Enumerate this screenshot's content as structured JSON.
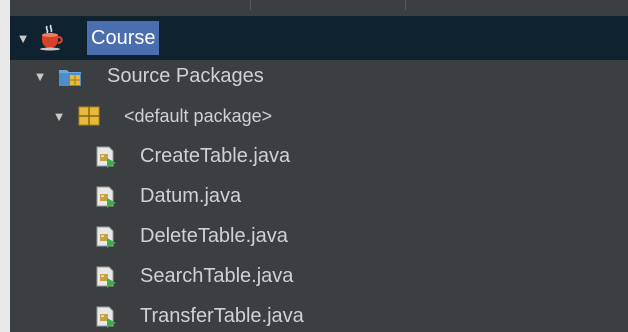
{
  "project_tree": {
    "root": {
      "label": "Course",
      "expanded": true,
      "selected": true,
      "icon": "java-project-cup-icon"
    },
    "source_packages": {
      "label": "Source Packages",
      "expanded": true,
      "icon": "source-packages-folder-icon"
    },
    "default_package": {
      "label": "<default package>",
      "expanded": true,
      "icon": "package-icon"
    },
    "files": [
      {
        "label": "CreateTable.java",
        "icon": "java-file-icon"
      },
      {
        "label": "Datum.java",
        "icon": "java-file-icon"
      },
      {
        "label": "DeleteTable.java",
        "icon": "java-file-icon"
      },
      {
        "label": "SearchTable.java",
        "icon": "java-file-icon"
      },
      {
        "label": "TransferTable.java",
        "icon": "java-file-icon"
      }
    ]
  },
  "colors": {
    "tree_background": "#3c3f41",
    "selected_background": "#4b6eaf",
    "root_row_background": "#0f2230",
    "text": "#cfd2d5"
  }
}
